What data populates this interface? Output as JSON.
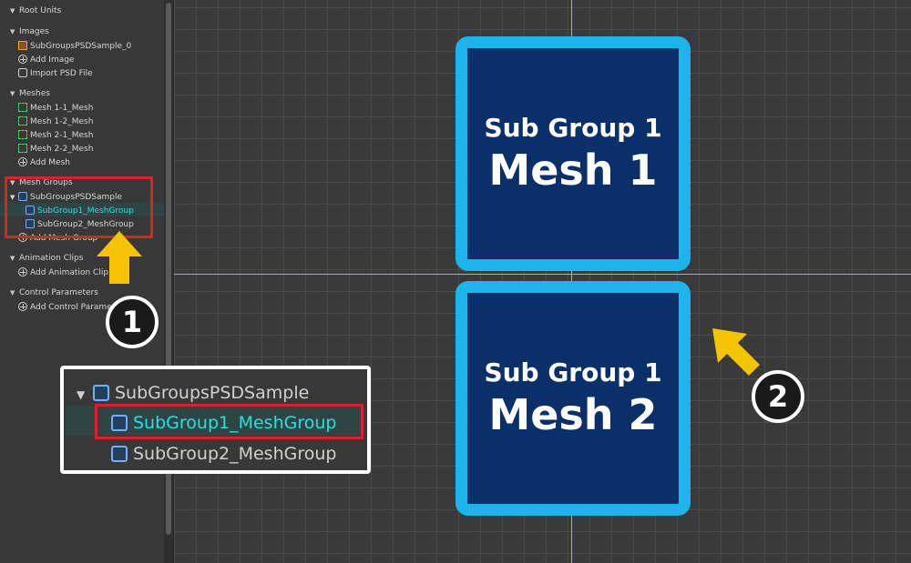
{
  "panel": {
    "root_units": "Root Units",
    "images": {
      "label": "Images",
      "items": [
        "SubGroupsPSDSample_0",
        "Add Image",
        "Import PSD File"
      ]
    },
    "meshes": {
      "label": "Meshes",
      "items": [
        "Mesh 1-1_Mesh",
        "Mesh 1-2_Mesh",
        "Mesh 2-1_Mesh",
        "Mesh 2-2_Mesh",
        "Add Mesh"
      ]
    },
    "mesh_groups": {
      "label": "Mesh Groups",
      "parent": "SubGroupsPSDSample",
      "children": [
        "SubGroup1_MeshGroup",
        "SubGroup2_MeshGroup"
      ],
      "add": "Add Mesh Group"
    },
    "animation_clips": {
      "label": "Animation Clips",
      "add": "Add Animation Clip"
    },
    "control_parameters": {
      "label": "Control Parameters",
      "add": "Add Control Parameter"
    }
  },
  "canvas": {
    "mesh1": {
      "line1": "Sub Group 1",
      "line2": "Mesh 1"
    },
    "mesh2": {
      "line1": "Sub Group 1",
      "line2": "Mesh 2"
    }
  },
  "zoom": {
    "parent": "SubGroupsPSDSample",
    "child1": "SubGroup1_MeshGroup",
    "child2": "SubGroup2_MeshGroup"
  },
  "badges": {
    "one": "1",
    "two": "2"
  },
  "colors": {
    "selected_text": "#27e0e0",
    "highlight_red": "#e01f26",
    "mesh_border": "#1cb4ea",
    "mesh_fill": "#0b2f69",
    "arrow_yellow": "#f5c400"
  }
}
